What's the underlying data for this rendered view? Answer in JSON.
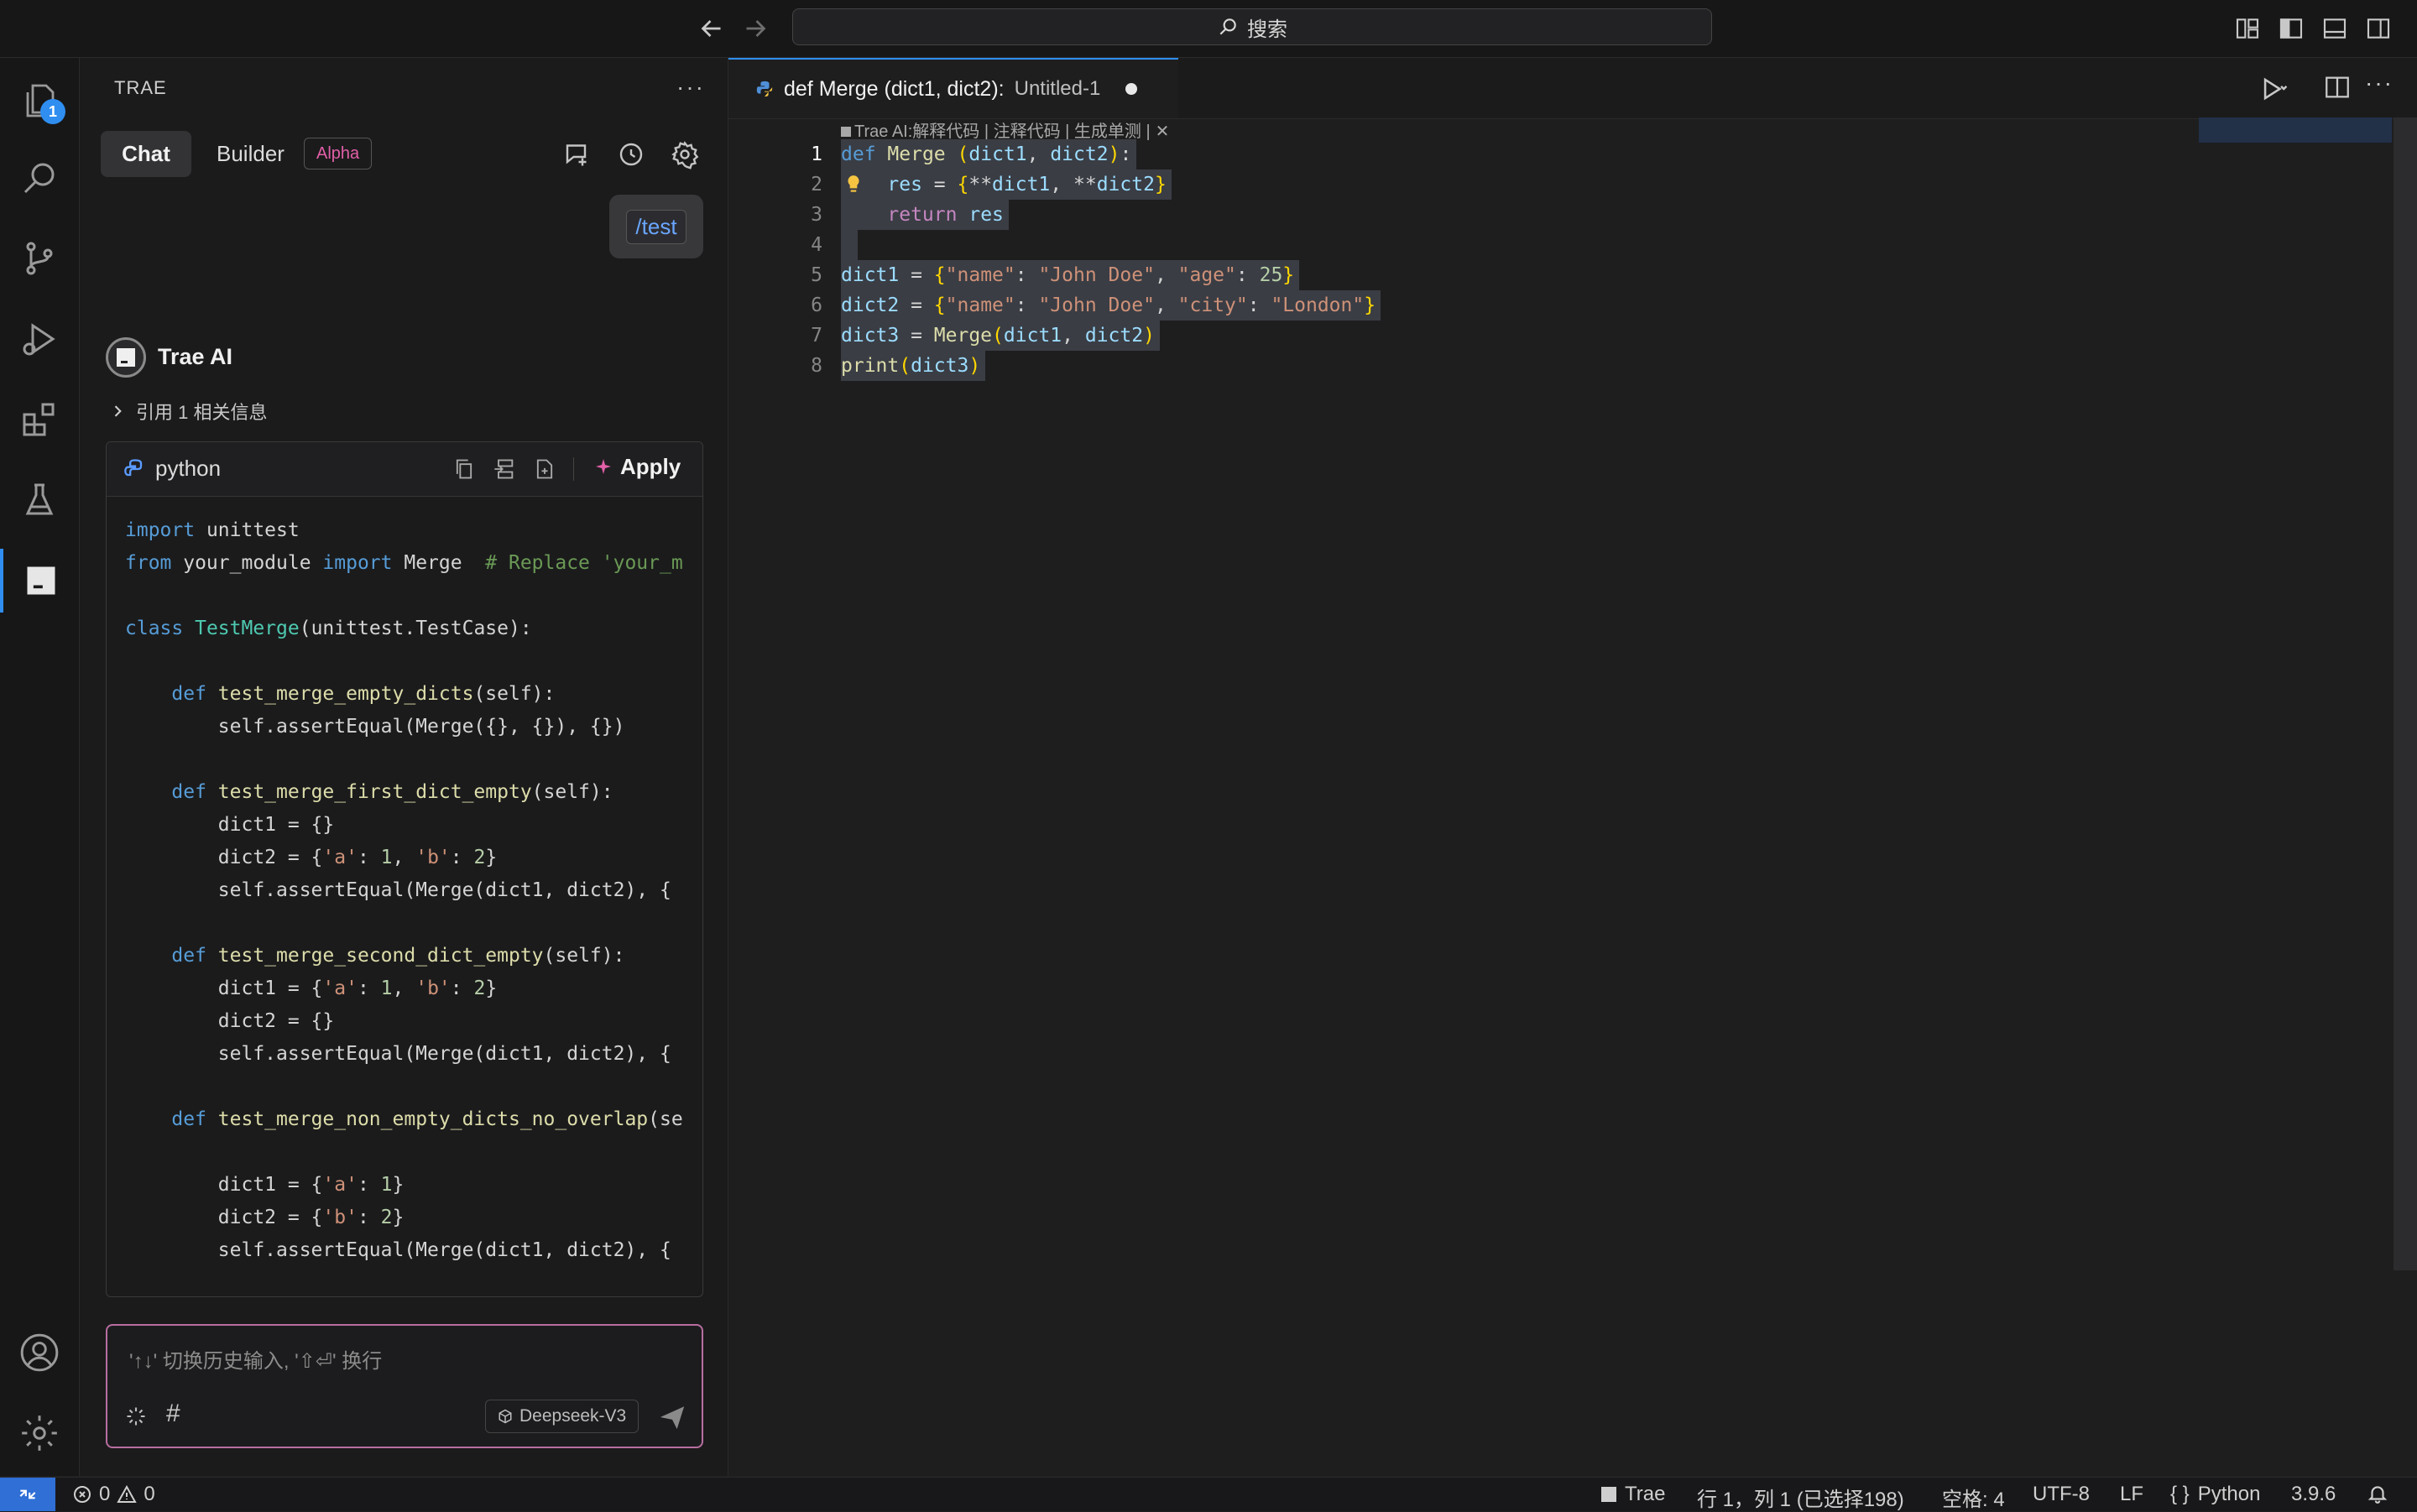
{
  "titlebar": {
    "search_label": "搜索"
  },
  "activity_bar": {
    "explorer_badge": "1"
  },
  "side_panel": {
    "title": "TRAE",
    "more": "···",
    "tabs": {
      "chat": "Chat",
      "builder": "Builder",
      "alpha": "Alpha"
    },
    "user_message": "/test",
    "ai_name": "Trae AI",
    "reference": "引用 1 相关信息",
    "code_block": {
      "language": "python",
      "apply_label": "Apply"
    },
    "input": {
      "placeholder": "'↑↓' 切换历史输入, '⇧⏎' 换行",
      "model": "Deepseek-V3",
      "hash": "#"
    }
  },
  "editor": {
    "tab_title": "def Merge (dict1, dict2):",
    "tab_file": "Untitled-1",
    "codelens": "Trae AI:解释代码 | 注释代码 | 生成单测 |",
    "line_numbers": [
      "1",
      "2",
      "3",
      "4",
      "5",
      "6",
      "7",
      "8"
    ]
  },
  "status_bar": {
    "errors": "0",
    "warnings": "0",
    "account": "Trae",
    "cursor": "行 1，列 1 (已选择198)",
    "spaces": "空格: 4",
    "encoding": "UTF-8",
    "eol": "LF",
    "language": "Python",
    "version": "3.9.6"
  }
}
